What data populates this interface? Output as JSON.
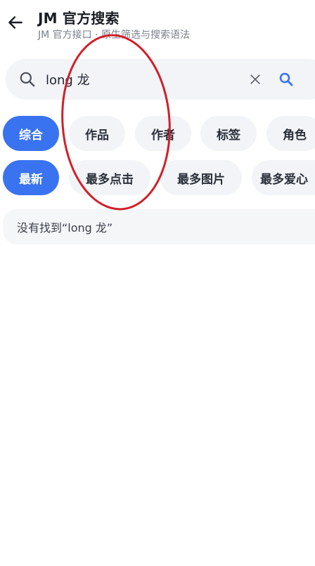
{
  "header": {
    "back_icon": "arrow-left-icon",
    "title": "JM 官方搜索",
    "subtitle": "JM 官方接口 · 原生筛选与搜索语法"
  },
  "search": {
    "icon": "search-icon",
    "value": "long 龙",
    "clear_icon": "close-icon",
    "submit_icon": "search-icon"
  },
  "filters": {
    "type_chips": [
      {
        "label": "综合",
        "active": true
      },
      {
        "label": "作品",
        "active": false
      },
      {
        "label": "作者",
        "active": false
      },
      {
        "label": "标签",
        "active": false
      },
      {
        "label": "角色",
        "active": false
      }
    ],
    "sort_chips": [
      {
        "label": "最新",
        "active": true
      },
      {
        "label": "最多点击",
        "active": false
      },
      {
        "label": "最多图片",
        "active": false
      },
      {
        "label": "最多爱心",
        "active": false
      }
    ]
  },
  "result": {
    "empty_message": "没有找到“long 龙”"
  },
  "colors": {
    "accent": "#3a73f0",
    "chip_bg": "#f2f4f7",
    "annotation": "#d0202a"
  }
}
